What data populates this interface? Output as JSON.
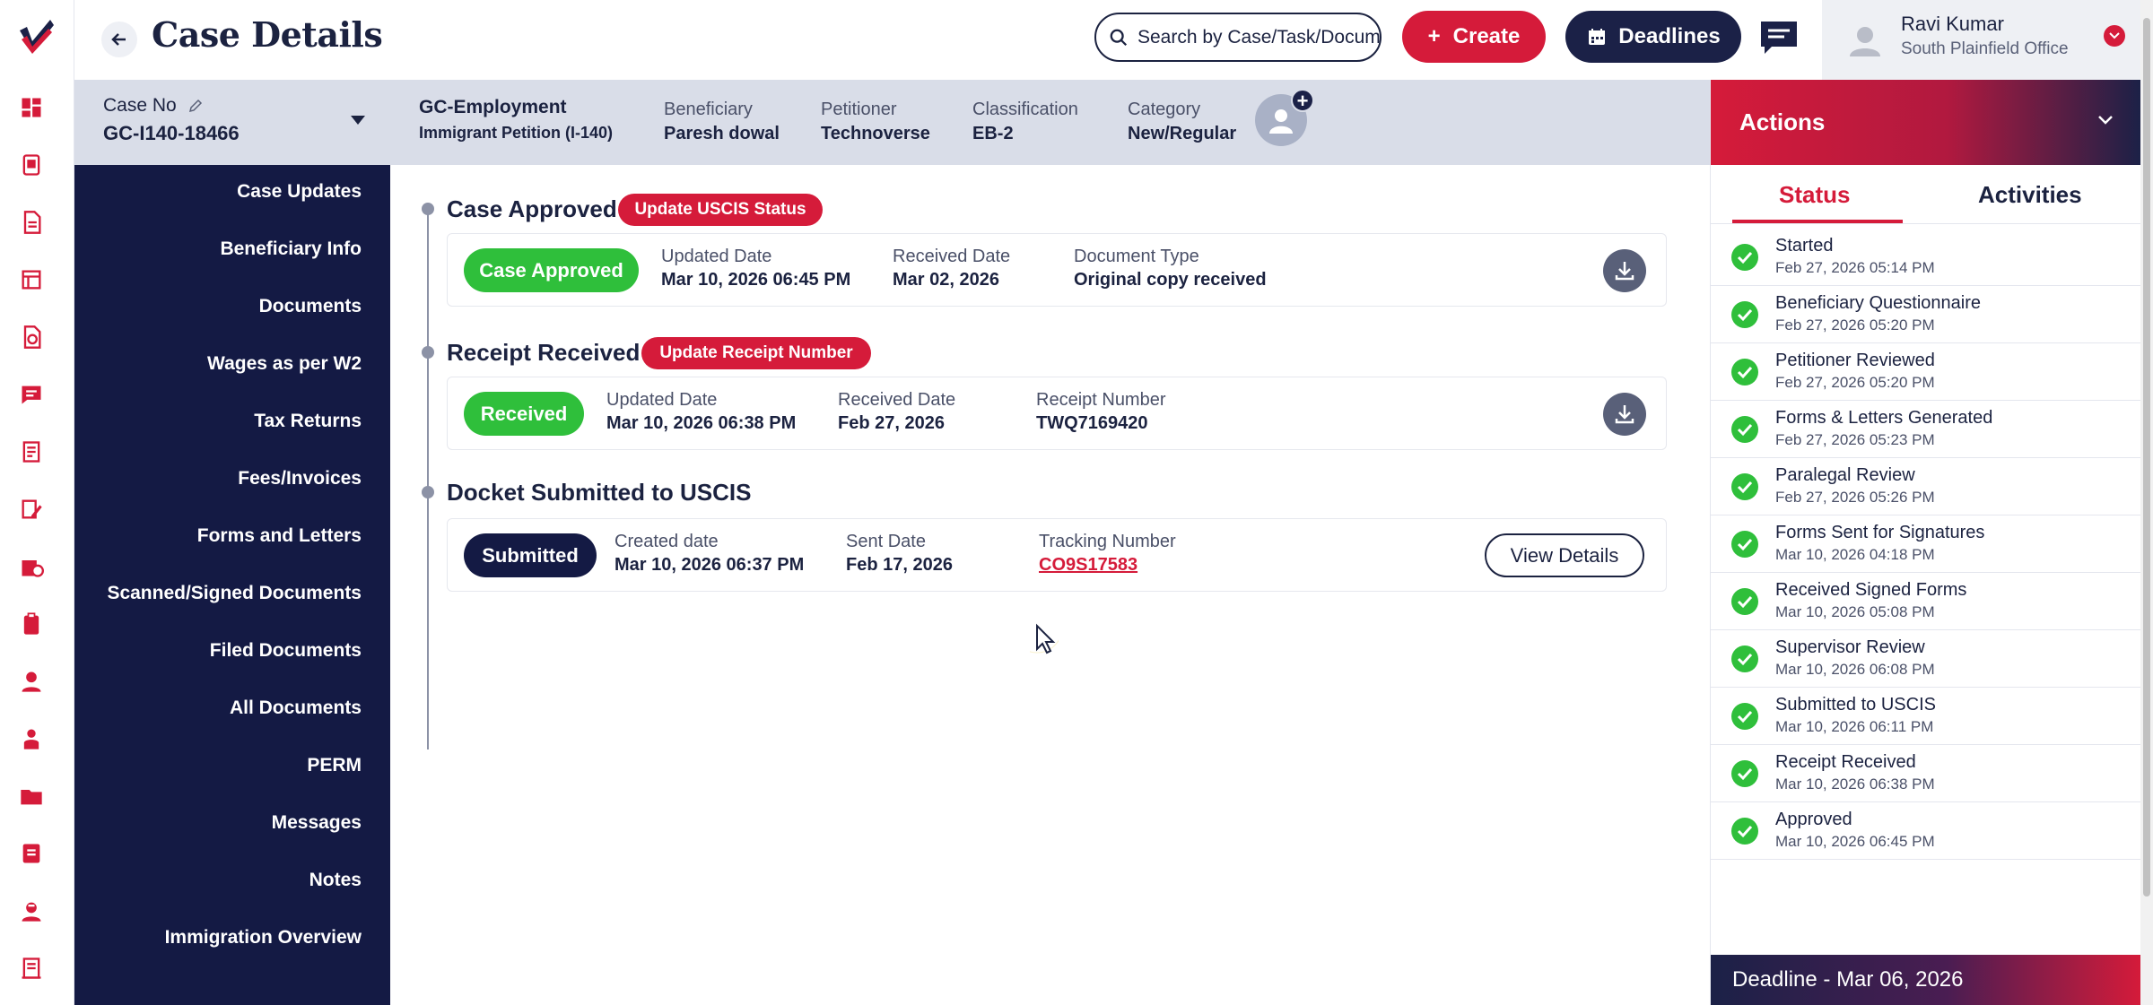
{
  "header": {
    "title": "Case Details",
    "search_placeholder": "Search by Case/Task/Document",
    "create_label": "Create",
    "deadlines_label": "Deadlines",
    "user_name": "Ravi Kumar",
    "user_office": "South Plainfield Office"
  },
  "rail": {
    "icons": [
      "dashboard-icon",
      "cases-icon",
      "documents-icon",
      "forms-icon",
      "checklist-icon",
      "messages-icon",
      "reports-icon",
      "edit-icon",
      "billing-icon",
      "clipboard-icon",
      "user-icon",
      "person-icon",
      "folder-icon",
      "notes-icon",
      "contact-icon",
      "ledger-icon"
    ]
  },
  "case": {
    "case_no_label": "Case No",
    "case_no": "GC-I140-18466",
    "type": "GC-Employment",
    "subtype": "Immigrant Petition (I-140)",
    "fields": [
      {
        "label": "Beneficiary",
        "value": "Paresh dowal"
      },
      {
        "label": "Petitioner",
        "value": "Technoverse"
      },
      {
        "label": "Classification",
        "value": "EB-2"
      },
      {
        "label": "Category",
        "value": "New/Regular"
      }
    ]
  },
  "nav": {
    "items": [
      "Case Updates",
      "Beneficiary Info",
      "Documents",
      "Wages as per W2",
      "Tax Returns",
      "Fees/Invoices",
      "Forms and Letters",
      "Scanned/Signed Documents",
      "Filed Documents",
      "All Documents",
      "PERM",
      "Messages",
      "Notes",
      "Immigration Overview"
    ]
  },
  "timeline": [
    {
      "title": "Case Approved",
      "action": "Update USCIS Status",
      "status": "Case Approved",
      "fields": [
        {
          "label": "Updated Date",
          "value": "Mar 10, 2026 06:45 PM"
        },
        {
          "label": "Received Date",
          "value": "Mar 02, 2026"
        },
        {
          "label": "Document Type",
          "value": "Original copy received"
        }
      ]
    },
    {
      "title": "Receipt Received",
      "action": "Update Receipt Number",
      "status": "Received",
      "fields": [
        {
          "label": "Updated Date",
          "value": "Mar 10, 2026 06:38 PM"
        },
        {
          "label": "Received Date",
          "value": "Feb 27, 2026"
        },
        {
          "label": "Receipt Number",
          "value": "TWQ7169420"
        }
      ]
    },
    {
      "title": "Docket Submitted to USCIS",
      "status": "Submitted",
      "fields": [
        {
          "label": "Created date",
          "value": "Mar 10, 2026 06:37 PM"
        },
        {
          "label": "Sent Date",
          "value": "Feb 17, 2026"
        },
        {
          "label": "Tracking Number",
          "value": "CO9S17583"
        }
      ],
      "button": "View Details"
    }
  ],
  "actions": {
    "title": "Actions",
    "tabs": [
      "Status",
      "Activities"
    ],
    "statuses": [
      {
        "name": "Started",
        "date": "Feb 27, 2026 05:14 PM"
      },
      {
        "name": "Beneficiary Questionnaire",
        "date": "Feb 27, 2026 05:20 PM"
      },
      {
        "name": "Petitioner Reviewed",
        "date": "Feb 27, 2026 05:20 PM"
      },
      {
        "name": "Forms & Letters Generated",
        "date": "Feb 27, 2026 05:23 PM"
      },
      {
        "name": "Paralegal Review",
        "date": "Feb 27, 2026 05:26 PM"
      },
      {
        "name": "Forms Sent for Signatures",
        "date": "Mar 10, 2026 04:18 PM"
      },
      {
        "name": "Received Signed Forms",
        "date": "Mar 10, 2026 05:08 PM"
      },
      {
        "name": "Supervisor Review",
        "date": "Mar 10, 2026 06:08 PM"
      },
      {
        "name": "Submitted to USCIS",
        "date": "Mar 10, 2026 06:11 PM"
      },
      {
        "name": "Receipt Received",
        "date": "Mar 10, 2026 06:38 PM"
      },
      {
        "name": "Approved",
        "date": "Mar 10, 2026 06:45 PM"
      }
    ],
    "deadline": "Deadline - Mar 06, 2026"
  },
  "colors": {
    "brand_red": "#d51b3a",
    "navy": "#141a44",
    "success_green": "#2fbf3b"
  }
}
